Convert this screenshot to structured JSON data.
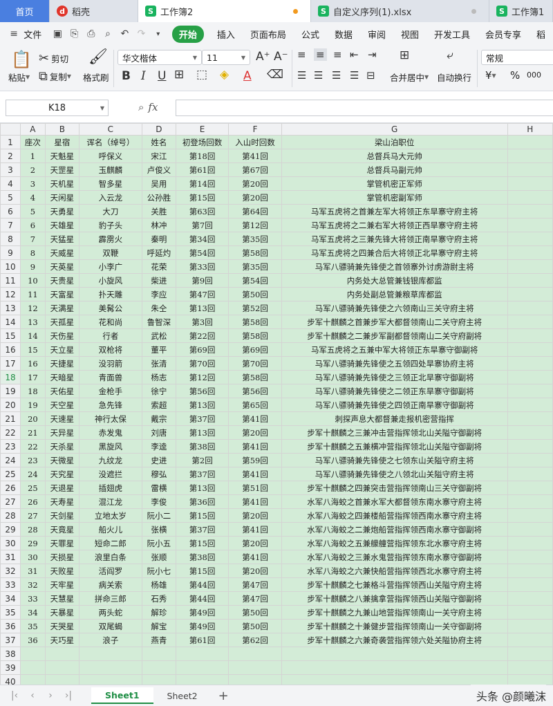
{
  "tabs": [
    {
      "label": "首页"
    },
    {
      "label": "稻壳",
      "icon": "daoke-logo-icon"
    },
    {
      "label": "工作簿2",
      "icon": "spreadsheet-logo-icon"
    },
    {
      "label": "自定义序列(1).xlsx",
      "icon": "spreadsheet-logo-icon"
    },
    {
      "label": "工作簿1",
      "icon": "spreadsheet-logo-icon"
    }
  ],
  "menu": {
    "file": "文件",
    "items": [
      "开始",
      "插入",
      "页面布局",
      "公式",
      "数据",
      "审阅",
      "视图",
      "开发工具",
      "会员专享",
      "稻"
    ]
  },
  "ribbon": {
    "paste": "粘贴",
    "cut": "剪切",
    "copy": "复制",
    "format_painter": "格式刷",
    "font_name": "华文楷体",
    "font_size": "11",
    "merge_center": "合并居中",
    "wrap_text": "自动换行",
    "number_format": "常规",
    "currency": "¥",
    "percent": "%",
    "thousands": "000"
  },
  "formula_bar": {
    "cell_ref": "K18",
    "fx": "fx",
    "value": ""
  },
  "columns": [
    "A",
    "B",
    "C",
    "D",
    "E",
    "F",
    "G",
    "H"
  ],
  "header_row": [
    "座次",
    "星宿",
    "诨名（绰号）",
    "姓名",
    "初登场回数",
    "入山时回数",
    "梁山泊职位"
  ],
  "selected_row": 18,
  "rows": [
    [
      "1",
      "天魁星",
      "呼保义",
      "宋江",
      "第18回",
      "第41回",
      "总督兵马大元帅"
    ],
    [
      "2",
      "天罡星",
      "玉麒麟",
      "卢俊义",
      "第61回",
      "第67回",
      "总督兵马副元帅"
    ],
    [
      "3",
      "天机星",
      "智多星",
      "吴用",
      "第14回",
      "第20回",
      "掌管机密正军师"
    ],
    [
      "4",
      "天闲星",
      "入云龙",
      "公孙胜",
      "第15回",
      "第20回",
      "掌管机密副军师"
    ],
    [
      "5",
      "天勇星",
      "大刀",
      "关胜",
      "第63回",
      "第64回",
      "马军五虎将之首兼左军大将领正东旱寨守府主将"
    ],
    [
      "6",
      "天雄星",
      "豹子头",
      "林冲",
      "第7回",
      "第12回",
      "马军五虎将之二兼右军大将领正西旱寨守府主将"
    ],
    [
      "7",
      "天猛星",
      "霹雳火",
      "秦明",
      "第34回",
      "第35回",
      "马军五虎将之三兼先锋大将领正南旱寨守府主将"
    ],
    [
      "8",
      "天威星",
      "双鞭",
      "呼延灼",
      "第54回",
      "第58回",
      "马军五虎将之四兼合后大将领正北旱寨守府主将"
    ],
    [
      "9",
      "天英星",
      "小李广",
      "花荣",
      "第33回",
      "第35回",
      "马军八骠骑兼先锋使之首领寨外讨虏游尉主将"
    ],
    [
      "10",
      "天贵星",
      "小旋风",
      "柴进",
      "第9回",
      "第54回",
      "内务处大总管兼钱银库都监"
    ],
    [
      "11",
      "天富星",
      "扑天雕",
      "李应",
      "第47回",
      "第50回",
      "内务处副总管兼粮草库都监"
    ],
    [
      "12",
      "天满星",
      "美髯公",
      "朱仝",
      "第13回",
      "第52回",
      "马军八骠骑兼先锋使之六领南山三关守府主将"
    ],
    [
      "13",
      "天孤星",
      "花和尚",
      "鲁智深",
      "第3回",
      "第58回",
      "步军十麒麟之首兼步军大都督领南山二关守府主将"
    ],
    [
      "14",
      "天伤星",
      "行者",
      "武松",
      "第22回",
      "第58回",
      "步军十麒麟之二兼步军副都督领南山二关守府副将"
    ],
    [
      "15",
      "天立星",
      "双枪将",
      "董平",
      "第69回",
      "第69回",
      "马军五虎将之五兼中军大将领正东旱寨守御副将"
    ],
    [
      "16",
      "天捷星",
      "没羽箭",
      "张清",
      "第70回",
      "第70回",
      "马军八骠骑兼先锋使之五领四处旱寨协府主将"
    ],
    [
      "17",
      "天暗星",
      "青面兽",
      "杨志",
      "第12回",
      "第58回",
      "马军八骠骑兼先锋使之三领正北旱寨守御副将"
    ],
    [
      "18",
      "天佑星",
      "金枪手",
      "徐宁",
      "第56回",
      "第56回",
      "马军八骠骑兼先锋使之二领正东旱寨守御副将"
    ],
    [
      "19",
      "天空星",
      "急先锋",
      "索超",
      "第13回",
      "第65回",
      "马军八骠骑兼先锋使之四领正南旱寨守御副将"
    ],
    [
      "20",
      "天速星",
      "神行太保",
      "戴宗",
      "第37回",
      "第41回",
      "刺探声息大都督兼走报机密营指挥"
    ],
    [
      "21",
      "天异星",
      "赤发鬼",
      "刘唐",
      "第13回",
      "第20回",
      "步军十麒麟之三兼冲击营指挥领北山关隘守御副将"
    ],
    [
      "22",
      "天杀星",
      "黑旋风",
      "李逵",
      "第38回",
      "第41回",
      "步军十麒麟之五兼横冲营指挥领北山关隘守御副将"
    ],
    [
      "23",
      "天微星",
      "九纹龙",
      "史进",
      "第2回",
      "第59回",
      "马军八骠骑兼先锋使之七领东山关隘守府主将"
    ],
    [
      "24",
      "天究星",
      "没遮拦",
      "穆弘",
      "第37回",
      "第41回",
      "马军八骠骑兼先锋使之八领北山关隘守府主将"
    ],
    [
      "25",
      "天退星",
      "插翅虎",
      "雷横",
      "第13回",
      "第51回",
      "步军十麒麟之四兼突击营指挥领南山三关守御副将"
    ],
    [
      "26",
      "天寿星",
      "混江龙",
      "李俊",
      "第36回",
      "第41回",
      "水军八海蛟之首兼水军大都督领东南水寨守府主将"
    ],
    [
      "27",
      "天剑星",
      "立地太岁",
      "阮小二",
      "第15回",
      "第20回",
      "水军八海蛟之四兼楼船营指挥领西南水寨守府主将"
    ],
    [
      "28",
      "天竟星",
      "船火儿",
      "张横",
      "第37回",
      "第41回",
      "水军八海蛟之二兼炮船营指挥领西南水寨守御副将"
    ],
    [
      "29",
      "天罪星",
      "短命二郎",
      "阮小五",
      "第15回",
      "第20回",
      "水军八海蛟之五兼艨艟营指挥领东北水寨守府主将"
    ],
    [
      "30",
      "天损星",
      "浪里白条",
      "张顺",
      "第38回",
      "第41回",
      "水军八海蛟之三兼水鬼营指挥领东南水寨守御副将"
    ],
    [
      "31",
      "天败星",
      "活阎罗",
      "阮小七",
      "第15回",
      "第20回",
      "水军八海蛟之六兼快船营指挥领西北水寨守府主将"
    ],
    [
      "32",
      "天牢星",
      "病关索",
      "杨雄",
      "第44回",
      "第47回",
      "步军十麒麟之七兼格斗营指挥领西山关隘守府主将"
    ],
    [
      "33",
      "天慧星",
      "拼命三郎",
      "石秀",
      "第44回",
      "第47回",
      "步军十麒麟之八兼擒拿营指挥领西山关隘守御副将"
    ],
    [
      "34",
      "天暴星",
      "两头蛇",
      "解珍",
      "第49回",
      "第50回",
      "步军十麒麟之九兼山地营指挥领南山一关守府主将"
    ],
    [
      "35",
      "天哭星",
      "双尾蝎",
      "解宝",
      "第49回",
      "第50回",
      "步军十麒麟之十兼健步营指挥领南山一关守御副将"
    ],
    [
      "36",
      "天巧星",
      "浪子",
      "燕青",
      "第61回",
      "第62回",
      "步军十麒麟之六兼奇袭营指挥领六处关隘协府主将"
    ]
  ],
  "empty_rows": [
    38,
    39,
    40
  ],
  "sheets": [
    "Sheet1",
    "Sheet2"
  ],
  "watermark": "头条 @颜曦沫",
  "colors": {
    "accent": "#1e8e44",
    "cell_fill": "#d3ecd7",
    "home_tab": "#4a7fe0"
  }
}
